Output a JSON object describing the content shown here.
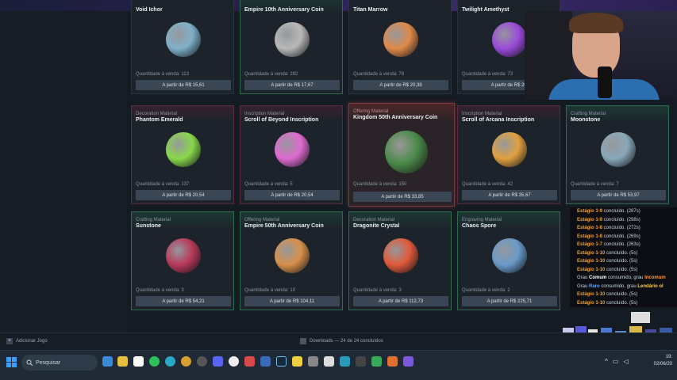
{
  "cards": [
    {
      "category": "",
      "name": "Void Ichor",
      "qty": "Quantidade à venda: 113",
      "price": "A partir de R$ 15,61",
      "color": "#7fb0c8",
      "style": "plain"
    },
    {
      "category": "",
      "name": "Empire 10th Anniversary Coin",
      "qty": "Quantidade à venda: 282",
      "price": "A partir de R$ 17,67",
      "color": "#b8b8b8",
      "style": "green"
    },
    {
      "category": "",
      "name": "Titan Marrow",
      "qty": "Quantidade à venda: 78",
      "price": "A partir de R$ 20,38",
      "color": "#e08a4a",
      "style": "plain"
    },
    {
      "category": "",
      "name": "Twilight Amethyst",
      "qty": "Quantidade à venda: 73",
      "price": "A partir de R$ 20,",
      "color": "#9a4ad8",
      "style": "plain"
    },
    {
      "category": "Decoration Material",
      "name": "Phantom Emerald",
      "qty": "Quantidade à venda: 137",
      "price": "A partir de R$ 20,54",
      "color": "#8ad84a",
      "style": "pink"
    },
    {
      "category": "Inscription Material",
      "name": "Scroll of Beyond Inscription",
      "qty": "Quantidade à venda: 5",
      "price": "A partir de R$ 20,54",
      "color": "#e06ad0",
      "style": "pink"
    },
    {
      "category": "Offering Material",
      "name": "Kingdom 50th Anniversary Coin",
      "qty": "Quantidade à venda: 150",
      "price": "A partir de R$ 33,85",
      "color": "#4a8a4a",
      "style": "active"
    },
    {
      "category": "Inscription Material",
      "name": "Scroll of Arcana Inscription",
      "qty": "Quantidade à venda: 42",
      "price": "A partir de R$ 35,67",
      "color": "#e0a040",
      "style": "pink"
    },
    {
      "category": "Crafting Material",
      "name": "Moonstone",
      "qty": "Quantidade à venda: 7",
      "price": "A partir de R$ 53,97",
      "color": "#8aa8b8",
      "style": "green"
    },
    {
      "category": "Crafting Material",
      "name": "Sunstone",
      "qty": "Quantidade à venda: 3",
      "price": "A partir de R$ 54,21",
      "color": "#b83a5a",
      "style": "green"
    },
    {
      "category": "Offering Material",
      "name": "Empire 50th Anniversary Coin",
      "qty": "Quantidade à venda: 10",
      "price": "A partir de R$ 104,11",
      "color": "#d8904a",
      "style": "green"
    },
    {
      "category": "Decoration Material",
      "name": "Dragonite Crystal",
      "qty": "Quantidade à venda: 3",
      "price": "A partir de R$ 112,73",
      "color": "#e05a3a",
      "style": "green"
    },
    {
      "category": "Engraving Material",
      "name": "Chaos Spore",
      "qty": "Quantidade à venda: 2",
      "price": "A partir de R$ 225,71",
      "color": "#6a9ac8",
      "style": "green"
    }
  ],
  "log": [
    {
      "a": "Estágio 1-9",
      "b": " concluído. (287s)",
      "cls": "stage"
    },
    {
      "a": "Estágio 1-9",
      "b": " concluído. (298s)",
      "cls": "stage"
    },
    {
      "a": "Estágio 1-8",
      "b": " concluído. (272s)",
      "cls": "stage"
    },
    {
      "a": "Estágio 1-8",
      "b": " concluído. (269s)",
      "cls": "stage"
    },
    {
      "a": "Estágio 1-7",
      "b": " concluído. (263s)",
      "cls": "stage"
    },
    {
      "a": "Estágio 1-10",
      "b": " concluído. (5s)",
      "cls": "stage"
    },
    {
      "a": "Estágio 1-10",
      "b": " concluído. (5s)",
      "cls": "stage"
    },
    {
      "a": "Estágio 1-10",
      "b": " concluído. (5s)",
      "cls": "stage"
    }
  ],
  "log_grau1": {
    "p1": "Grau ",
    "g1": "Comum",
    "p2": " consumido, grau ",
    "g2": "Incomum"
  },
  "log_grau2": {
    "p1": "Grau ",
    "g1": "Raro",
    "p2": " consumido, grau ",
    "g2": "Lendário ol"
  },
  "log_tail": [
    {
      "a": "Estágio 1-10",
      "b": " concluído. (5s)"
    },
    {
      "a": "Estágio 1-10",
      "b": " concluído. (5s)"
    }
  ],
  "bottom": {
    "add_game": "Adicionar Jogo",
    "downloads": "Downloads — 24 de 24 concluídos"
  },
  "taskbar": {
    "search": "Pesquisar",
    "time": "19:",
    "date": "02/06/20"
  }
}
